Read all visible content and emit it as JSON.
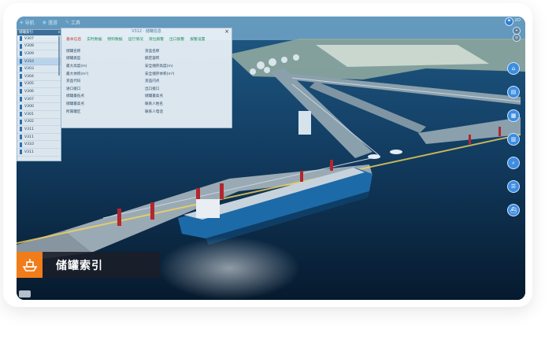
{
  "toolbar": {
    "items": [
      "导航",
      "漫游",
      "工具"
    ]
  },
  "panel": {
    "title": "储罐索引",
    "items": [
      "V307",
      "V308",
      "V309",
      "V310",
      "V303",
      "V304",
      "V305",
      "V306",
      "V307",
      "V300",
      "V301",
      "V302",
      "V311",
      "V311",
      "V310",
      "V311"
    ]
  },
  "info": {
    "title": "V312 · 储罐信息",
    "close": "×",
    "tabs": [
      "基本信息",
      "实时数据",
      "物料数据",
      "运行情况",
      "液位报警",
      "出口报警",
      "报警设置"
    ],
    "rows": [
      [
        "储罐名称",
        "货品名称"
      ],
      [
        "储罐类型",
        "额定容积"
      ],
      [
        "最大高度(m)",
        "安全储存高度(m)"
      ],
      [
        "最大体积(m³)",
        "安全储存体积(m³)"
      ],
      [
        "货品代码",
        "货品闪点"
      ],
      [
        "进口接口",
        "出口接口"
      ],
      [
        "储罐最低点",
        "储罐最高点"
      ],
      [
        "储罐最高点",
        "联系人姓名"
      ],
      [
        "所属罐区",
        "联系人电话"
      ]
    ]
  },
  "side_tools": [
    "home-icon",
    "chart-icon",
    "building-icon",
    "factory-icon",
    "search-icon",
    "list-icon",
    "ship-icon"
  ],
  "corner": {
    "view_label": "2D"
  },
  "caption": {
    "text": "储罐索引"
  },
  "colors": {
    "caption_icon_bg": "#f07d1a",
    "tool_blue": "#3d8de0",
    "sea": "#0d2a47"
  }
}
